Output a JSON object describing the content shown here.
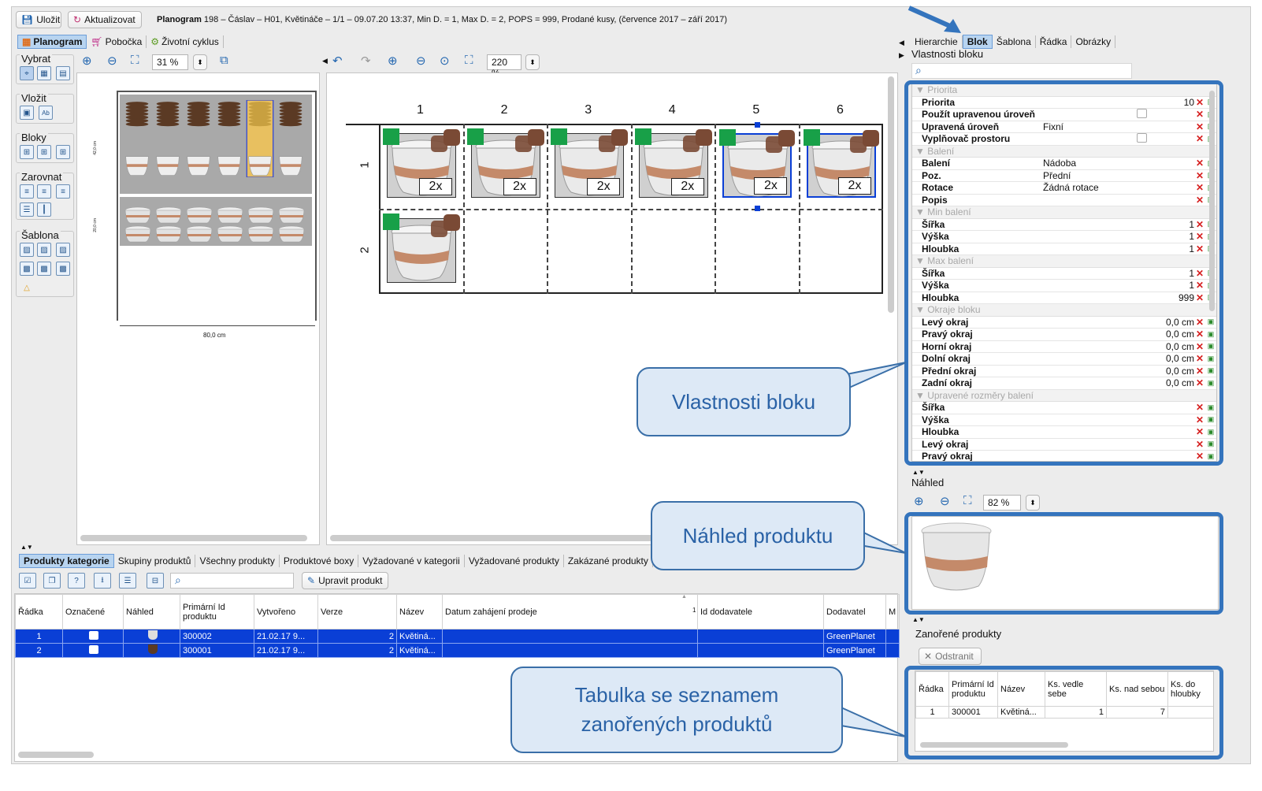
{
  "toolbar": {
    "save": "Uložit",
    "refresh": "Aktualizovat",
    "title_bold": "Planogram",
    "title_rest": " 198 – Čáslav – H01, Květináče – 1/1 – 09.07.20 13:37, Min D. = 1, Max D. = 2, POPS = 999, Prodané kusy, (července 2017 – září 2017)"
  },
  "left_tabs": [
    "Planogram",
    "Pobočka",
    "Životní cyklus"
  ],
  "tools": {
    "select": "Vybrat",
    "insert": "Vložit",
    "blocks": "Bloky",
    "align": "Zarovnat",
    "template": "Šablona"
  },
  "overview": {
    "zoom": "31 %",
    "shelf1_height": "42,0 cm",
    "shelf2_height": "20,0 cm",
    "width": "80,0 cm"
  },
  "detail": {
    "zoom": "220 %",
    "columns": [
      "1",
      "2",
      "3",
      "4",
      "5",
      "6"
    ],
    "rows": [
      "1",
      "2"
    ],
    "count_label": "2x"
  },
  "bottom": {
    "tabs": [
      "Produkty kategorie",
      "Skupiny produktů",
      "Všechny produkty",
      "Produktové boxy",
      "Vyžadované v kategorii",
      "Vyžadované produkty",
      "Zakázané produkty"
    ],
    "edit_button": "Upravit produkt",
    "columns": [
      "Řádka",
      "Označené",
      "Náhled",
      "Primární Id produktu",
      "Vytvořeno",
      "Verze",
      "Název",
      "Datum zahájení prodeje",
      "Id dodavatele",
      "Dodavatel",
      "M"
    ],
    "sort_index": "1",
    "rows": [
      {
        "row": "1",
        "id": "300002",
        "created": "21.02.17 9...",
        "version": "2",
        "name": "Květiná...",
        "supplier": "GreenPlanet"
      },
      {
        "row": "2",
        "id": "300001",
        "created": "21.02.17 9...",
        "version": "2",
        "name": "Květiná...",
        "supplier": "GreenPlanet"
      }
    ]
  },
  "right_tabs": [
    "Hierarchie",
    "Blok",
    "Šablona",
    "Řádka",
    "Obrázky"
  ],
  "props": {
    "title": "Vlastnosti bloku",
    "sections": [
      {
        "name": "Priorita",
        "rows": [
          {
            "k": "Priorita",
            "n": "10"
          },
          {
            "k": "Použít upravenou úroveň",
            "check": true
          },
          {
            "k": "Upravená úroveň",
            "v": "Fixní"
          },
          {
            "k": "Vyplňovač prostoru",
            "check": true
          }
        ]
      },
      {
        "name": "Balení",
        "rows": [
          {
            "k": "Balení",
            "v": "Nádoba"
          },
          {
            "k": "Poz.",
            "v": "Přední"
          },
          {
            "k": "Rotace",
            "v": "Žádná rotace"
          },
          {
            "k": "Popis"
          }
        ]
      },
      {
        "name": "Min balení",
        "rows": [
          {
            "k": "Šířka",
            "n": "1"
          },
          {
            "k": "Výška",
            "n": "1"
          },
          {
            "k": "Hloubka",
            "n": "1"
          }
        ]
      },
      {
        "name": "Max balení",
        "rows": [
          {
            "k": "Šířka",
            "n": "1"
          },
          {
            "k": "Výška",
            "n": "1"
          },
          {
            "k": "Hloubka",
            "n": "999"
          }
        ]
      },
      {
        "name": "Okraje bloku",
        "rows": [
          {
            "k": "Levý okraj",
            "n": "0,0 cm"
          },
          {
            "k": "Pravý okraj",
            "n": "0,0 cm"
          },
          {
            "k": "Horní okraj",
            "n": "0,0 cm"
          },
          {
            "k": "Dolní okraj",
            "n": "0,0 cm"
          },
          {
            "k": "Přední okraj",
            "n": "0,0 cm"
          },
          {
            "k": "Zadní okraj",
            "n": "0,0 cm"
          }
        ]
      },
      {
        "name": "Upravené rozměry balení",
        "rows": [
          {
            "k": "Šířka"
          },
          {
            "k": "Výška"
          },
          {
            "k": "Hloubka"
          },
          {
            "k": "Levý okraj"
          },
          {
            "k": "Pravý okraj"
          }
        ]
      }
    ]
  },
  "preview": {
    "title": "Náhled",
    "zoom": "82 %"
  },
  "nested": {
    "title": "Zanořené produkty",
    "remove": "Odstranit",
    "columns": [
      "Řádka",
      "Primární Id produktu",
      "Název",
      "Ks. vedle sebe",
      "Ks. nad sebou",
      "Ks. do hloubky"
    ],
    "rows": [
      {
        "row": "1",
        "id": "300001",
        "name": "Květiná...",
        "side": "1",
        "above": "7",
        "depth": ""
      }
    ]
  },
  "callouts": {
    "props": "Vlastnosti bloku",
    "preview": "Náhled produktu",
    "table_line1": "Tabulka se seznamem",
    "table_line2": "zanořených produktů"
  },
  "colors": {
    "accent": "#3474bd",
    "selection": "#0a3fd6",
    "green": "#18a048",
    "brown": "#7a4a35"
  }
}
